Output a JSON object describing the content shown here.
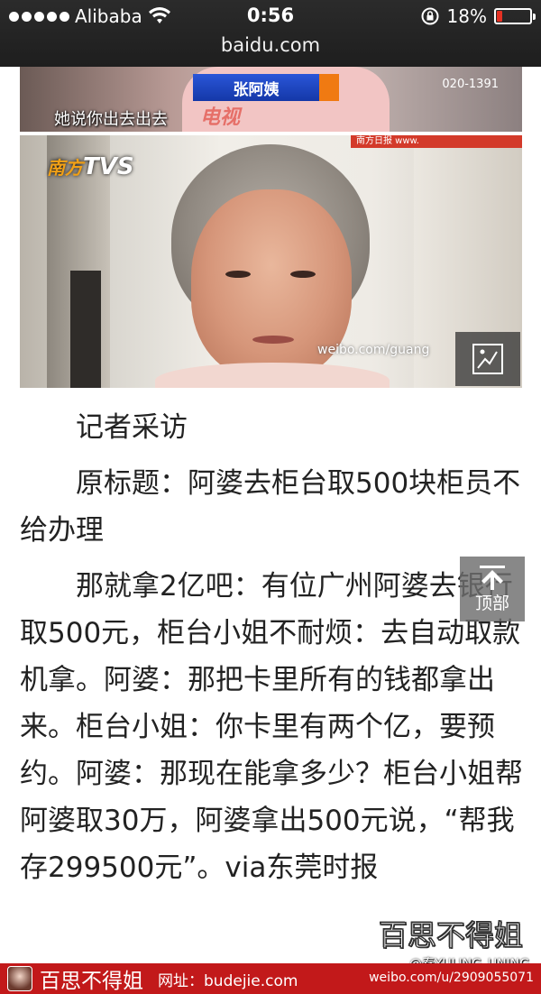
{
  "status_bar": {
    "carrier": "Alibaba",
    "time": "0:56",
    "battery_percent": "18%",
    "battery_level": 0.18,
    "battery_color": "#e53123",
    "url": "baidu.com"
  },
  "images": {
    "top": {
      "name_tag": "张阿姨",
      "caption": "她说你出去出去",
      "watermark": "电视",
      "phone": "020-1391"
    },
    "main": {
      "channel_logo": "TVS",
      "channel_prefix": "南方",
      "source_strip": "南方日报 www.",
      "weibo_watermark": "weibo.com/guang"
    }
  },
  "article": {
    "paragraphs": [
      "记者采访",
      "原标题：阿婆去柜台取500块柜员不给办理",
      "那就拿2亿吧：有位广州阿婆去银行取500元，柜台小姐不耐烦：去自动取款机拿。阿婆：那把卡里所有的钱都拿出来。柜台小姐：你卡里有两个亿，要预约。阿婆：那现在能拿多少？柜台小姐帮阿婆取30万，阿婆拿出500元说，“帮我存299500元”。via东莞时报"
    ]
  },
  "to_top": {
    "label": "顶部"
  },
  "overlay": {
    "brand_watermark": "百思不得姐",
    "handle": "@秦YULING_UNING"
  },
  "footer": {
    "brand": "百思不得姐",
    "site": "网址：budejie.com",
    "weibo": "weibo.com/u/2909055071",
    "bar_color": "#c2191a"
  }
}
